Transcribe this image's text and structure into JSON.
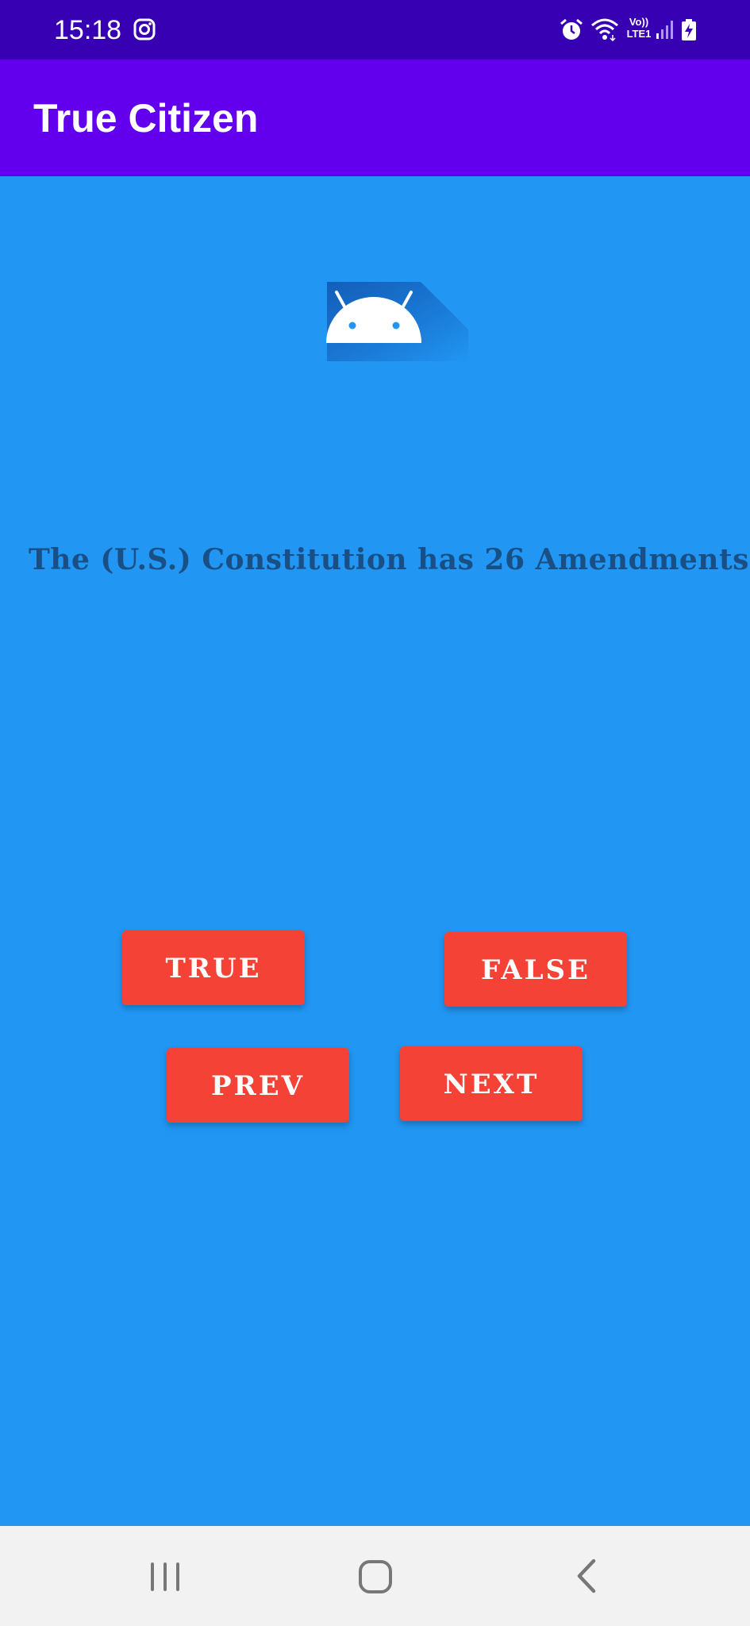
{
  "status_bar": {
    "time": "15:18",
    "icons": [
      "instagram-icon",
      "alarm-icon",
      "wifi-icon",
      "volte-lte-icon",
      "signal-icon",
      "battery-charging-icon"
    ],
    "lte_label_top": "Vo))",
    "lte_label_bottom": "LTE1"
  },
  "app_bar": {
    "title": "True Citizen",
    "color": "#6200EE"
  },
  "main": {
    "background": "#2196F3",
    "logo_icon": "android-icon",
    "question": "The (U.S.) Constitution has 26 Amendments",
    "buttons": {
      "true_label": "TRUE",
      "false_label": "FALSE",
      "prev_label": "PREV",
      "next_label": "NEXT"
    },
    "button_color": "#F44336"
  },
  "nav_bar": {
    "icons": [
      "recent-apps-icon",
      "home-icon",
      "back-icon"
    ]
  }
}
